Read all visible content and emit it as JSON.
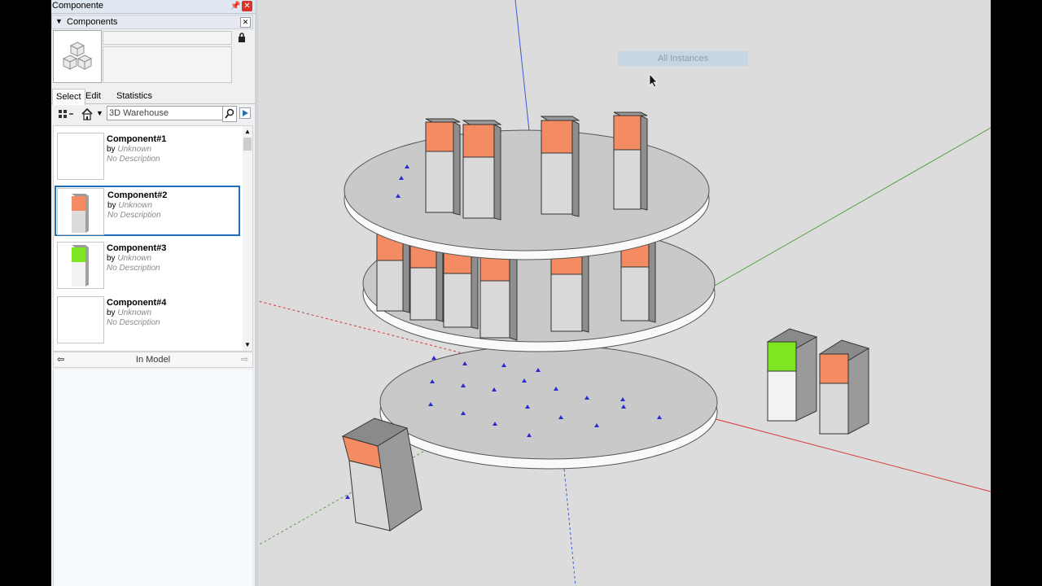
{
  "panel": {
    "window_title": "Componente",
    "section_title": "Components"
  },
  "tabs": [
    {
      "label": "Select"
    },
    {
      "label": "Edit"
    },
    {
      "label": "Statistics"
    }
  ],
  "search": {
    "value": "3D Warehouse"
  },
  "components": [
    {
      "name": "Component#1",
      "by_prefix": "by",
      "author": "Unknown",
      "description": "No Description",
      "color": null
    },
    {
      "name": "Component#2",
      "by_prefix": "by",
      "author": "Unknown",
      "description": "No Description",
      "color": "#f48b62"
    },
    {
      "name": "Component#3",
      "by_prefix": "by",
      "author": "Unknown",
      "description": "No Description",
      "color": "#7fe522"
    },
    {
      "name": "Component#4",
      "by_prefix": "by",
      "author": "Unknown",
      "description": "No Description",
      "color": null
    }
  ],
  "footer": {
    "label": "In Model"
  },
  "viewport": {
    "tooltip": "All Instances"
  },
  "colors": {
    "orange": "#f48b62",
    "green": "#7fe522",
    "selection": "#1e6fb8",
    "axis_red": "#d33",
    "axis_green": "#4a4",
    "axis_blue": "#33d"
  },
  "icons": [
    "pin-icon",
    "close-icon",
    "lock-icon",
    "view-options-icon",
    "home-icon",
    "search-icon",
    "details-arrow-icon",
    "scroll-up-icon",
    "scroll-down-icon",
    "back-icon",
    "forward-icon",
    "cursor-icon"
  ]
}
